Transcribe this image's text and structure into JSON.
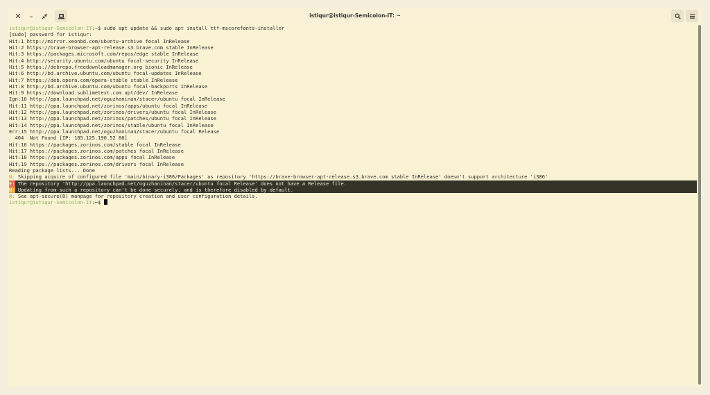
{
  "window": {
    "title": "istiqur@istiqur-Semicolon-IT: ~",
    "icons": {
      "close": "close-icon",
      "minimize": "minimize-icon",
      "restore": "restore-icon",
      "new_tab": "new-tab-icon",
      "search": "search-icon",
      "menu": "hamburger-menu-icon"
    }
  },
  "terminal": {
    "prompt_user": "istiqur@istiqur-Semicolon-IT",
    "prompt_symbol": ":~$ ",
    "command": "sudo apt update && sudo apt install ttf-mscorefonts-installer",
    "output_lines": [
      "[sudo] password for istiqur:",
      "Hit:1 http://mirror.xeonbd.com/ubuntu-archive focal InRelease",
      "Hit:2 https://brave-browser-apt-release.s3.brave.com stable InRelease",
      "Hit:3 https://packages.microsoft.com/repos/edge stable InRelease",
      "Hit:4 http://security.ubuntu.com/ubuntu focal-security InRelease",
      "Hit:5 https://debrepo.freedownloadmanager.org bionic InRelease",
      "Hit:6 http://bd.archive.ubuntu.com/ubuntu focal-updates InRelease",
      "Hit:7 https://deb.opera.com/opera-stable stable InRelease",
      "Hit:8 http://bd.archive.ubuntu.com/ubuntu focal-backports InRelease",
      "Hit:9 https://download.sublimetext.com apt/dev/ InRelease",
      "Ign:10 http://ppa.launchpad.net/oguzhaninan/stacer/ubuntu focal InRelease",
      "Hit:11 http://ppa.launchpad.net/zorinos/apps/ubuntu focal InRelease",
      "Hit:12 http://ppa.launchpad.net/zorinos/drivers/ubuntu focal InRelease",
      "Hit:13 http://ppa.launchpad.net/zorinos/patches/ubuntu focal InRelease",
      "Hit:14 http://ppa.launchpad.net/zorinos/stable/ubuntu focal InRelease",
      "Err:15 http://ppa.launchpad.net/oguzhaninan/stacer/ubuntu focal Release",
      "  404  Not Found [IP: 185.125.190.52 80]",
      "Hit:16 https://packages.zorinos.com/stable focal InRelease",
      "Hit:17 https://packages.zorinos.com/patches focal InRelease",
      "Hit:18 https://packages.zorinos.com/apps focal InRelease",
      "Hit:19 https://packages.zorinos.com/drivers focal InRelease",
      "Reading package lists... Done"
    ],
    "messages": [
      {
        "tag": "N:",
        "kind": "w",
        "text": " Skipping acquire of configured file 'main/binary-i386/Packages' as repository 'https://brave-browser-apt-release.s3.brave.com stable InRelease' doesn't support architecture 'i386'"
      },
      {
        "tag": "E:",
        "kind": "e",
        "text": " The repository 'http://ppa.launchpad.net/oguzhaninan/stacer/ubuntu focal Release' does not have a Release file."
      },
      {
        "tag": "N:",
        "kind": "w2",
        "text": " Updating from such a repository can't be done securely, and is therefore disabled by default."
      },
      {
        "tag": "N:",
        "kind": "w",
        "text": " See apt-secure(8) manpage for repository creation and user configuration details."
      }
    ]
  }
}
